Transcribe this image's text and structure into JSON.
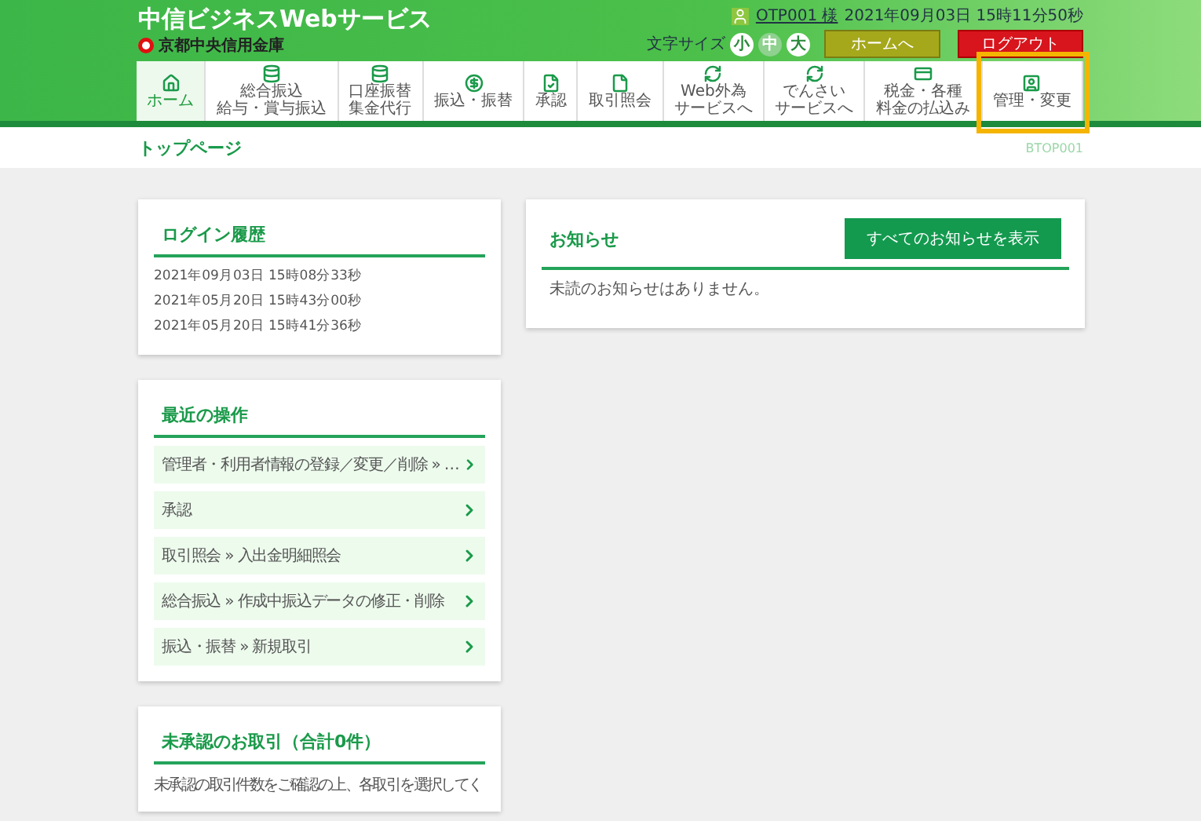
{
  "header": {
    "title": "中信ビジネスWebサービス",
    "bank": "京都中央信用金庫",
    "user": "OTP001 様",
    "datetime": "2021年09月03日 15時11分50秒",
    "font_size_label": "文字サイズ",
    "font_sizes": [
      {
        "label": "小",
        "selected": false
      },
      {
        "label": "中",
        "selected": true
      },
      {
        "label": "大",
        "selected": false
      }
    ],
    "home_button": "ホームへ",
    "logout_button": "ログアウト"
  },
  "nav": {
    "items": [
      {
        "lines": [
          "ホーム"
        ],
        "selected": true,
        "highlighted": false
      },
      {
        "lines": [
          "総合振込",
          "給与・賞与振込"
        ],
        "selected": false,
        "highlighted": false
      },
      {
        "lines": [
          "口座振替",
          "集金代行"
        ],
        "selected": false,
        "highlighted": false
      },
      {
        "lines": [
          "振込・振替"
        ],
        "selected": false,
        "highlighted": false
      },
      {
        "lines": [
          "承認"
        ],
        "selected": false,
        "highlighted": false
      },
      {
        "lines": [
          "取引照会"
        ],
        "selected": false,
        "highlighted": false
      },
      {
        "lines": [
          "Web外為",
          "サービスへ"
        ],
        "selected": false,
        "highlighted": false
      },
      {
        "lines": [
          "でんさい",
          "サービスへ"
        ],
        "selected": false,
        "highlighted": false
      },
      {
        "lines": [
          "税金・各種",
          "料金の払込み"
        ],
        "selected": false,
        "highlighted": false
      },
      {
        "lines": [
          "管理・変更"
        ],
        "selected": false,
        "highlighted": true
      }
    ]
  },
  "breadcrumb": {
    "title": "トップページ",
    "screen_id": "BTOP001"
  },
  "login_history": {
    "title": "ログイン履歴",
    "entries": [
      "2021年09月03日 15時08分33秒",
      "2021年05月20日 15時43分00秒",
      "2021年05月20日 15時41分36秒"
    ]
  },
  "notices": {
    "title": "お知らせ",
    "button": "すべてのお知らせを表示",
    "message": "未読のお知らせはありません。"
  },
  "recent": {
    "title": "最近の操作",
    "items": [
      "管理者・利用者情報の登録／変更／削除 » …",
      "承認",
      "取引照会 » 入出金明細照会",
      "総合振込 » 作成中振込データの修正・削除",
      "振込・振替 » 新規取引"
    ]
  },
  "pending": {
    "title": "未承認のお取引（合計0件）",
    "message": "未承認の取引件数をご確認の上、各取引を選択してく"
  }
}
